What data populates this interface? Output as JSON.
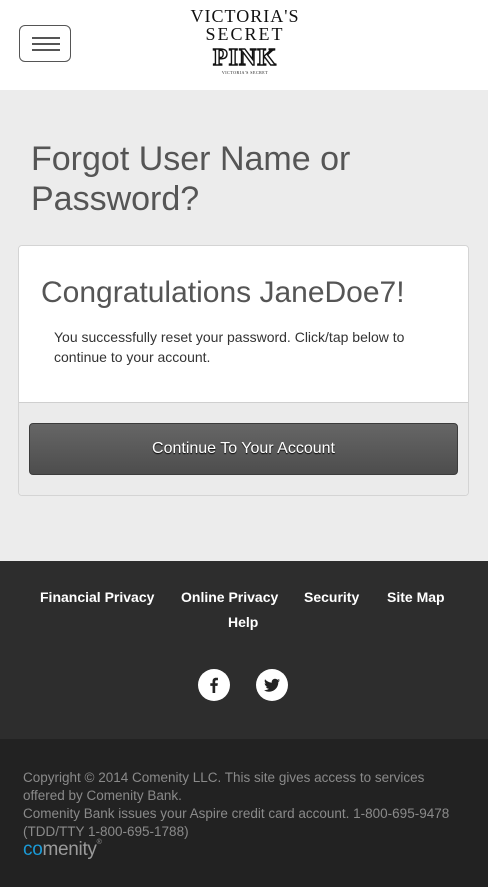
{
  "header": {
    "menu_label": "Menu",
    "logo_line1": "VICTORIA'S",
    "logo_line2": "SECRET",
    "logo_pink": "PINK",
    "logo_sub": "VICTORIA'S SECRET"
  },
  "page": {
    "title": "Forgot User Name or Password?"
  },
  "card": {
    "heading": "Congratulations JaneDoe7!",
    "message": "You successfully reset your password. Click/tap below to continue to your account.",
    "button_label": "Continue To Your Account"
  },
  "footer": {
    "links": {
      "financial_privacy": "Financial Privacy",
      "online_privacy": "Online Privacy",
      "security": "Security",
      "site_map": "Site Map",
      "help": "Help"
    },
    "social": [
      "facebook-icon",
      "twitter-icon"
    ],
    "copyright": "Copyright © 2014 Comenity LLC. This site gives access to services offered by Comenity Bank.",
    "issuer": "Comenity Bank issues your Aspire credit card account. 1-800-695-9478 (TDD/TTY 1-800-695-1788)",
    "brand_co": "co",
    "brand_rest": "menity",
    "brand_tm": "®"
  },
  "colors": {
    "page_bg": "#ececec",
    "footer_top_bg": "#2d2d2d",
    "footer_bottom_bg": "#222222",
    "button_bg": "#555555",
    "brand_accent": "#1a9ad6"
  }
}
